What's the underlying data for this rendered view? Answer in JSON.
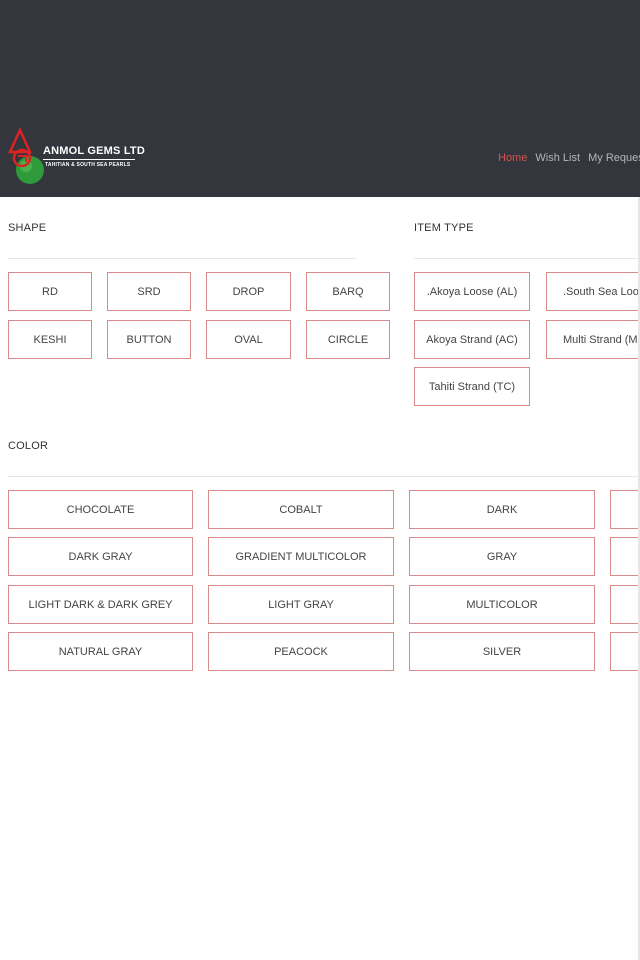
{
  "brand": {
    "name": "ANMOL GEMS LTD",
    "tagline": "TAHITIAN & SOUTH SEA PEARLS",
    "logo_icon": "pearl-logo"
  },
  "nav": {
    "items": [
      "Home",
      "Wish List",
      "My Request",
      "My"
    ],
    "active_color": "#d9534f"
  },
  "shape": {
    "title": "SHAPE",
    "options": [
      "RD",
      "SRD",
      "DROP",
      "BARQ",
      "KESHI",
      "BUTTON",
      "OVAL",
      "CIRCLE"
    ]
  },
  "item_type": {
    "title": "ITEM TYPE",
    "options": [
      ".Akoya Loose (AL)",
      ".South Sea Loose (Sl",
      "Akoya Strand (AC)",
      "Multi Strand (MC)",
      "Tahiti Strand (TC)"
    ]
  },
  "color": {
    "title": "COLOR",
    "options": [
      "CHOCOLATE",
      "COBALT",
      "DARK",
      "",
      "DARK GRAY",
      "GRADIENT MULTICOLOR",
      "GRAY",
      "",
      "LIGHT DARK & DARK GREY",
      "LIGHT GRAY",
      "MULTICOLOR",
      "",
      "NATURAL GRAY",
      "PEACOCK",
      "SILVER",
      ""
    ]
  },
  "colors": {
    "header_bg": "#33363d",
    "button_border": "#d98b8b",
    "accent": "#d9534f"
  }
}
